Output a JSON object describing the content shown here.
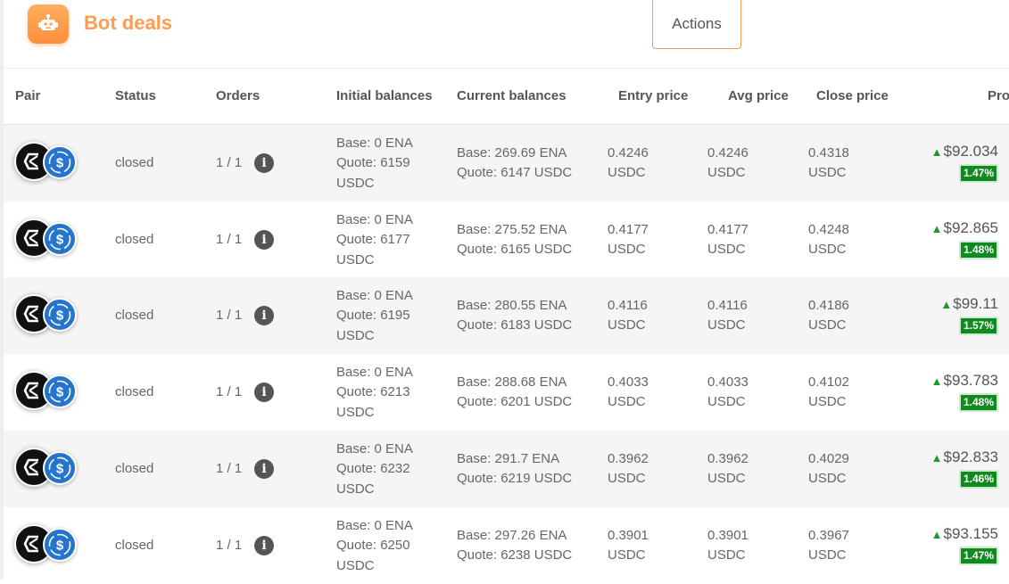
{
  "header": {
    "title": "Bot deals",
    "actions_label": "Actions",
    "icon": "robot-icon"
  },
  "columns": {
    "pair": "Pair",
    "status": "Status",
    "orders": "Orders",
    "initial": "Initial balances",
    "current": "Current balances",
    "entry": "Entry price",
    "avg": "Avg price",
    "close": "Close price",
    "profit": "Pro"
  },
  "colors": {
    "accent": "#ff9b55",
    "profit_badge": "#0e8a1f",
    "usdc": "#2775ca",
    "ena": "#111111"
  },
  "rows": [
    {
      "status": "closed",
      "orders": "1 / 1",
      "init_base": "Base: 0 ENA",
      "init_quote": "Quote: 6159",
      "init_unit": "USDC",
      "cur_base": "Base: 269.69 ENA",
      "cur_quote": "Quote: 6147 USDC",
      "entry": "0.4246",
      "entry_unit": "USDC",
      "avg": "0.4246",
      "avg_unit": "USDC",
      "close": "0.4318",
      "close_unit": "USDC",
      "profit": "$92.034",
      "pct": "1.47%"
    },
    {
      "status": "closed",
      "orders": "1 / 1",
      "init_base": "Base: 0 ENA",
      "init_quote": "Quote: 6177",
      "init_unit": "USDC",
      "cur_base": "Base: 275.52 ENA",
      "cur_quote": "Quote: 6165 USDC",
      "entry": "0.4177",
      "entry_unit": "USDC",
      "avg": "0.4177",
      "avg_unit": "USDC",
      "close": "0.4248",
      "close_unit": "USDC",
      "profit": "$92.865",
      "pct": "1.48%"
    },
    {
      "status": "closed",
      "orders": "1 / 1",
      "init_base": "Base: 0 ENA",
      "init_quote": "Quote: 6195",
      "init_unit": "USDC",
      "cur_base": "Base: 280.55 ENA",
      "cur_quote": "Quote: 6183 USDC",
      "entry": "0.4116",
      "entry_unit": "USDC",
      "avg": "0.4116",
      "avg_unit": "USDC",
      "close": "0.4186",
      "close_unit": "USDC",
      "profit": "$99.11",
      "pct": "1.57%"
    },
    {
      "status": "closed",
      "orders": "1 / 1",
      "init_base": "Base: 0 ENA",
      "init_quote": "Quote: 6213",
      "init_unit": "USDC",
      "cur_base": "Base: 288.68 ENA",
      "cur_quote": "Quote: 6201 USDC",
      "entry": "0.4033",
      "entry_unit": "USDC",
      "avg": "0.4033",
      "avg_unit": "USDC",
      "close": "0.4102",
      "close_unit": "USDC",
      "profit": "$93.783",
      "pct": "1.48%"
    },
    {
      "status": "closed",
      "orders": "1 / 1",
      "init_base": "Base: 0 ENA",
      "init_quote": "Quote: 6232",
      "init_unit": "USDC",
      "cur_base": "Base: 291.7 ENA",
      "cur_quote": "Quote: 6219 USDC",
      "entry": "0.3962",
      "entry_unit": "USDC",
      "avg": "0.3962",
      "avg_unit": "USDC",
      "close": "0.4029",
      "close_unit": "USDC",
      "profit": "$92.833",
      "pct": "1.46%"
    },
    {
      "status": "closed",
      "orders": "1 / 1",
      "init_base": "Base: 0 ENA",
      "init_quote": "Quote: 6250",
      "init_unit": "USDC",
      "cur_base": "Base: 297.26 ENA",
      "cur_quote": "Quote: 6238 USDC",
      "entry": "0.3901",
      "entry_unit": "USDC",
      "avg": "0.3901",
      "avg_unit": "USDC",
      "close": "0.3967",
      "close_unit": "USDC",
      "profit": "$93.155",
      "pct": "1.47%"
    }
  ]
}
